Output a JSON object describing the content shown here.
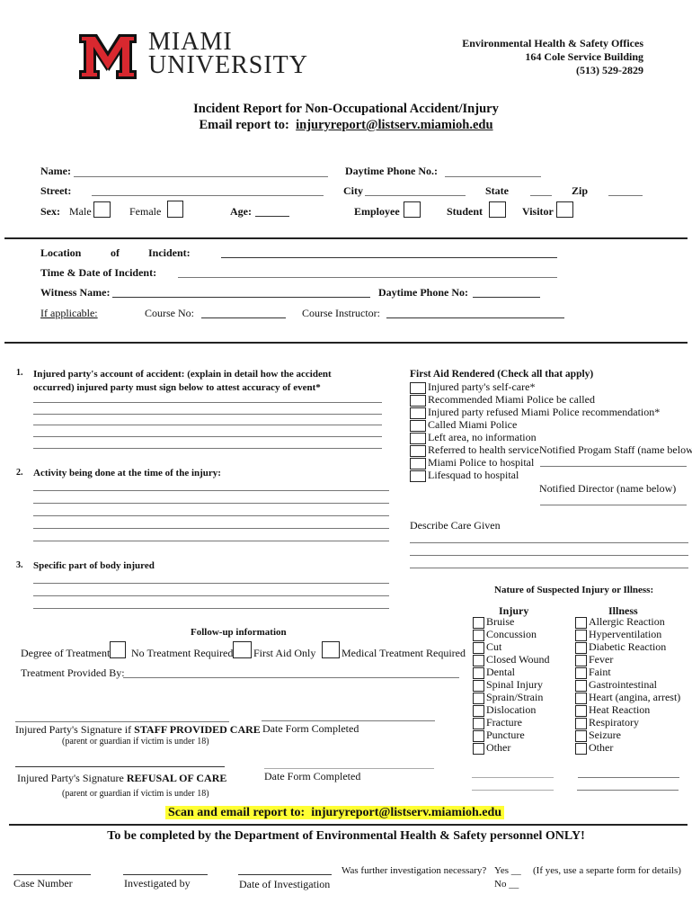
{
  "header": {
    "logo_line1": "MIAMI",
    "logo_line2": "UNIVERSITY",
    "office_lines": [
      "Environmental Health & Safety Offices",
      "164 Cole Service Building",
      "(513) 529-2829"
    ],
    "title": "Incident Report for Non-Occupational Accident/Injury",
    "email_prefix": "Email report to:",
    "email": "injuryreport@listserv.miamioh.edu"
  },
  "colors": {
    "brand_red": "#d8282f",
    "highlight": "#ffff33"
  },
  "personal": {
    "name_label": "Name:",
    "phone_label": "Daytime Phone No.:",
    "street_label": "Street:",
    "city_label": "City",
    "state_label": "State",
    "zip_label": "Zip",
    "sex_label": "Sex:",
    "male_label": "Male",
    "female_label": "Female",
    "age_label": "Age:",
    "employee_label": "Employee",
    "student_label": "Student",
    "visitor_label": "Visitor"
  },
  "incident": {
    "location_label_1": "Location",
    "location_label_2": "of",
    "location_label_3": "Incident:",
    "time_label": "Time & Date of Incident:",
    "witness_label": "Witness Name:",
    "witness_phone_label": "Daytime Phone No:",
    "if_applicable": "If applicable:",
    "course_no_label": "Course No:",
    "course_instructor_label": "Course Instructor:"
  },
  "questions": [
    {
      "num": "1.",
      "text_line1": "Injured party's account of accident:  (explain in detail how the accident",
      "text_line2": "occurred) injured party must sign below to attest accuracy of event*"
    },
    {
      "num": "2.",
      "text_line1": "Activity being done at the time of the injury:"
    },
    {
      "num": "3.",
      "text_line1": "Specific part of body injured"
    }
  ],
  "first_aid": {
    "heading": "First Aid Rendered (Check all that apply)",
    "options": [
      "Injured party's self-care*",
      "Recommended Miami Police be called",
      "Injured party refused Miami Police recommendation*",
      "Called Miami Police",
      "Left area, no information",
      "Referred to health service",
      "Miami Police to hospital",
      "Lifesquad to hospital"
    ],
    "notified_staff_label": "Notified Progam Staff (name below)",
    "notified_director_label": "Notified Director (name below)",
    "describe_care_label": "Describe Care Given"
  },
  "nature": {
    "heading": "Nature of Suspected Injury or Illness:",
    "injury_heading": "Injury",
    "illness_heading": "Illness",
    "injury": [
      "Bruise",
      "Concussion",
      "Cut",
      "Closed Wound",
      "Dental",
      "Spinal Injury",
      "Sprain/Strain",
      "Dislocation",
      "Fracture",
      "Puncture",
      "Other"
    ],
    "illness": [
      "Allergic Reaction",
      "Hyperventilation",
      "Diabetic Reaction",
      "Fever",
      "Faint",
      "Gastrointestinal",
      "Heart (angina, arrest)",
      "Heat Reaction",
      "Respiratory",
      "Seizure",
      "Other"
    ]
  },
  "followup": {
    "heading": "Follow-up information",
    "degree_label": "Degree of Treatment:",
    "no_treatment": "No Treatment Required",
    "first_aid_only": "First Aid Only",
    "medical_treatment": "Medical Treatment Required",
    "provided_by_label": "Treatment Provided By:"
  },
  "signatures": {
    "staff_care_prefix": "Injured Party's Signature if ",
    "staff_care_bold": "STAFF PROVIDED CARE",
    "refusal_prefix": "Injured Party's Signature ",
    "refusal_bold": "REFUSAL OF CARE",
    "guardian_note": "(parent or guardian if victim is under 18)",
    "date_completed_label": "Date Form Completed"
  },
  "footer": {
    "scan_email_prefix": "Scan and email report to:",
    "scan_email": "injuryreport@listserv.miamioh.edu",
    "ehs_only": "To be completed by the Department of Environmental Health & Safety personnel ONLY!",
    "case_number_label": "Case Number",
    "investigated_by_label": "Investigated by",
    "date_investigation_label": "Date of Investigation",
    "further_question": "Was further investigation necessary?",
    "yes_label": "Yes __",
    "no_label": "No __",
    "if_yes_note": "(If yes, use a separte form for details)"
  }
}
